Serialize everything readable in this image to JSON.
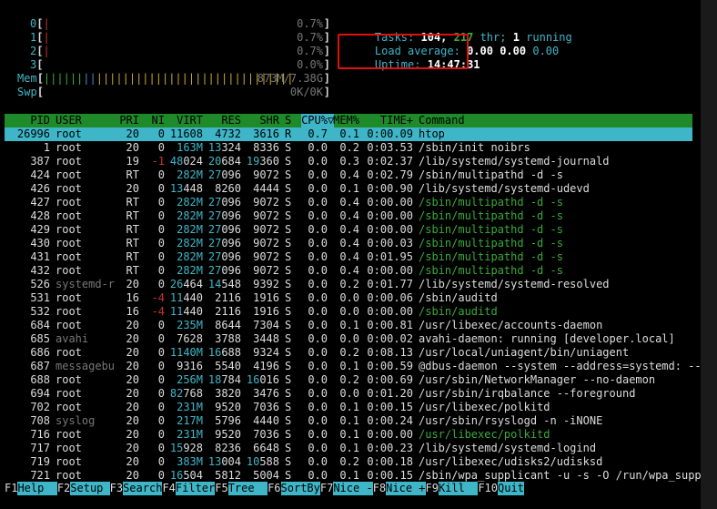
{
  "meters": {
    "cpus": [
      {
        "label": "0",
        "value": "0.7%"
      },
      {
        "label": "1",
        "value": "0.7%"
      },
      {
        "label": "2",
        "value": "0.7%"
      },
      {
        "label": "3",
        "value": "0.0%"
      }
    ],
    "mem": {
      "label": "Mem",
      "bars": "||||||||||||||||||||||||||||||||||||||||",
      "value": "873M/7.38G",
      "fraction": 0.12
    },
    "swp": {
      "label": "Swp",
      "value": "0K/0K"
    }
  },
  "summary": {
    "tasks_label": "Tasks:",
    "tasks": "104,",
    "threads": "217",
    "thr_label": "thr;",
    "running": "1",
    "running_label": "running",
    "load_label": "Load average:",
    "load1": "0.00",
    "load5": "0.00",
    "load15": "0.00",
    "uptime_label": "Uptime:",
    "uptime": "14:47:31"
  },
  "columns": {
    "pid": "PID",
    "user": "USER",
    "pri": "PRI",
    "ni": "NI",
    "virt": "VIRT",
    "res": "RES",
    "shr": "SHR",
    "s": "S",
    "cpu": "CPU%",
    "sort_indicator": "▽",
    "mem": "MEM%",
    "time": "TIME+",
    "command": "Command"
  },
  "processes": [
    {
      "pid": "26996",
      "user": "root",
      "pri": "20",
      "ni": "0",
      "virt": "11608",
      "res": "4732",
      "shr": "3616",
      "s": "R",
      "cpu": "0.7",
      "mem": "0.1",
      "time": "0:00.09",
      "command": "htop",
      "selected": true
    },
    {
      "pid": "1",
      "user": "root",
      "pri": "20",
      "ni": "0",
      "virt": "163M",
      "res": "13324",
      "shr": "8336",
      "s": "S",
      "cpu": "0.0",
      "mem": "0.2",
      "time": "0:03.53",
      "command": "/sbin/init noibrs"
    },
    {
      "pid": "387",
      "user": "root",
      "pri": "19",
      "ni": "-1",
      "virt": "48024",
      "res": "20684",
      "shr": "19360",
      "s": "S",
      "cpu": "0.0",
      "mem": "0.3",
      "time": "0:02.37",
      "command": "/lib/systemd/systemd-journald"
    },
    {
      "pid": "424",
      "user": "root",
      "pri": "RT",
      "ni": "0",
      "virt": "282M",
      "res": "27096",
      "shr": "9072",
      "s": "S",
      "cpu": "0.0",
      "mem": "0.4",
      "time": "0:02.79",
      "command": "/sbin/multipathd -d -s"
    },
    {
      "pid": "426",
      "user": "root",
      "pri": "20",
      "ni": "0",
      "virt": "13448",
      "res": "8260",
      "shr": "4444",
      "s": "S",
      "cpu": "0.0",
      "mem": "0.1",
      "time": "0:00.90",
      "command": "/lib/systemd/systemd-udevd"
    },
    {
      "pid": "427",
      "user": "root",
      "pri": "RT",
      "ni": "0",
      "virt": "282M",
      "res": "27096",
      "shr": "9072",
      "s": "S",
      "cpu": "0.0",
      "mem": "0.4",
      "time": "0:00.00",
      "command": "/sbin/multipathd -d -s",
      "thread": true
    },
    {
      "pid": "428",
      "user": "root",
      "pri": "RT",
      "ni": "0",
      "virt": "282M",
      "res": "27096",
      "shr": "9072",
      "s": "S",
      "cpu": "0.0",
      "mem": "0.4",
      "time": "0:00.00",
      "command": "/sbin/multipathd -d -s",
      "thread": true
    },
    {
      "pid": "429",
      "user": "root",
      "pri": "RT",
      "ni": "0",
      "virt": "282M",
      "res": "27096",
      "shr": "9072",
      "s": "S",
      "cpu": "0.0",
      "mem": "0.4",
      "time": "0:00.00",
      "command": "/sbin/multipathd -d -s",
      "thread": true
    },
    {
      "pid": "430",
      "user": "root",
      "pri": "RT",
      "ni": "0",
      "virt": "282M",
      "res": "27096",
      "shr": "9072",
      "s": "S",
      "cpu": "0.0",
      "mem": "0.4",
      "time": "0:00.03",
      "command": "/sbin/multipathd -d -s",
      "thread": true
    },
    {
      "pid": "431",
      "user": "root",
      "pri": "RT",
      "ni": "0",
      "virt": "282M",
      "res": "27096",
      "shr": "9072",
      "s": "S",
      "cpu": "0.0",
      "mem": "0.4",
      "time": "0:01.95",
      "command": "/sbin/multipathd -d -s",
      "thread": true
    },
    {
      "pid": "432",
      "user": "root",
      "pri": "RT",
      "ni": "0",
      "virt": "282M",
      "res": "27096",
      "shr": "9072",
      "s": "S",
      "cpu": "0.0",
      "mem": "0.4",
      "time": "0:00.00",
      "command": "/sbin/multipathd -d -s",
      "thread": true
    },
    {
      "pid": "526",
      "user": "systemd-r",
      "pri": "20",
      "ni": "0",
      "virt": "26464",
      "res": "14548",
      "shr": "9392",
      "s": "S",
      "cpu": "0.0",
      "mem": "0.2",
      "time": "0:01.77",
      "command": "/lib/systemd/systemd-resolved",
      "grey_user": true
    },
    {
      "pid": "531",
      "user": "root",
      "pri": "16",
      "ni": "-4",
      "virt": "11440",
      "res": "2116",
      "shr": "1916",
      "s": "S",
      "cpu": "0.0",
      "mem": "0.0",
      "time": "0:00.06",
      "command": "/sbin/auditd"
    },
    {
      "pid": "532",
      "user": "root",
      "pri": "16",
      "ni": "-4",
      "virt": "11440",
      "res": "2116",
      "shr": "1916",
      "s": "S",
      "cpu": "0.0",
      "mem": "0.0",
      "time": "0:00.00",
      "command": "/sbin/auditd",
      "thread": true
    },
    {
      "pid": "684",
      "user": "root",
      "pri": "20",
      "ni": "0",
      "virt": "235M",
      "res": "8644",
      "shr": "7304",
      "s": "S",
      "cpu": "0.0",
      "mem": "0.1",
      "time": "0:00.81",
      "command": "/usr/libexec/accounts-daemon"
    },
    {
      "pid": "685",
      "user": "avahi",
      "pri": "20",
      "ni": "0",
      "virt": "7628",
      "res": "3788",
      "shr": "3448",
      "s": "S",
      "cpu": "0.0",
      "mem": "0.0",
      "time": "0:00.02",
      "command": "avahi-daemon: running [developer.local]",
      "grey_user": true
    },
    {
      "pid": "686",
      "user": "root",
      "pri": "20",
      "ni": "0",
      "virt": "1140M",
      "res": "16688",
      "shr": "9324",
      "s": "S",
      "cpu": "0.0",
      "mem": "0.2",
      "time": "0:08.13",
      "command": "/usr/local/uniagent/bin/uniagent"
    },
    {
      "pid": "687",
      "user": "messagebu",
      "pri": "20",
      "ni": "0",
      "virt": "9316",
      "res": "5540",
      "shr": "4196",
      "s": "S",
      "cpu": "0.0",
      "mem": "0.1",
      "time": "0:00.59",
      "command": "@dbus-daemon --system --address=systemd: --",
      "grey_user": true
    },
    {
      "pid": "688",
      "user": "root",
      "pri": "20",
      "ni": "0",
      "virt": "256M",
      "res": "18784",
      "shr": "16016",
      "s": "S",
      "cpu": "0.0",
      "mem": "0.2",
      "time": "0:00.69",
      "command": "/usr/sbin/NetworkManager --no-daemon"
    },
    {
      "pid": "694",
      "user": "root",
      "pri": "20",
      "ni": "0",
      "virt": "82768",
      "res": "3820",
      "shr": "3476",
      "s": "S",
      "cpu": "0.0",
      "mem": "0.0",
      "time": "0:01.20",
      "command": "/usr/sbin/irqbalance --foreground"
    },
    {
      "pid": "702",
      "user": "root",
      "pri": "20",
      "ni": "0",
      "virt": "231M",
      "res": "9520",
      "shr": "7036",
      "s": "S",
      "cpu": "0.0",
      "mem": "0.1",
      "time": "0:00.15",
      "command": "/usr/libexec/polkitd"
    },
    {
      "pid": "708",
      "user": "syslog",
      "pri": "20",
      "ni": "0",
      "virt": "217M",
      "res": "5796",
      "shr": "4440",
      "s": "S",
      "cpu": "0.0",
      "mem": "0.1",
      "time": "0:00.24",
      "command": "/usr/sbin/rsyslogd -n -iNONE",
      "grey_user": true
    },
    {
      "pid": "716",
      "user": "root",
      "pri": "20",
      "ni": "0",
      "virt": "231M",
      "res": "9520",
      "shr": "7036",
      "s": "S",
      "cpu": "0.0",
      "mem": "0.1",
      "time": "0:00.00",
      "command": "/usr/libexec/polkitd",
      "thread": true
    },
    {
      "pid": "717",
      "user": "root",
      "pri": "20",
      "ni": "0",
      "virt": "15928",
      "res": "8236",
      "shr": "6648",
      "s": "S",
      "cpu": "0.0",
      "mem": "0.1",
      "time": "0:00.23",
      "command": "/lib/systemd/systemd-logind"
    },
    {
      "pid": "719",
      "user": "root",
      "pri": "20",
      "ni": "0",
      "virt": "383M",
      "res": "13004",
      "shr": "10588",
      "s": "S",
      "cpu": "0.0",
      "mem": "0.2",
      "time": "0:00.18",
      "command": "/usr/libexec/udisks2/udisksd"
    },
    {
      "pid": "721",
      "user": "root",
      "pri": "20",
      "ni": "0",
      "virt": "16504",
      "res": "5812",
      "shr": "5004",
      "s": "S",
      "cpu": "0.0",
      "mem": "0.1",
      "time": "0:00.15",
      "command": "/sbin/wpa_supplicant -u -s -O /run/wpa_supp"
    }
  ],
  "footer": [
    {
      "key": "F1",
      "name": "Help  "
    },
    {
      "key": "F2",
      "name": "Setup "
    },
    {
      "key": "F3",
      "name": "Search"
    },
    {
      "key": "F4",
      "name": "Filter"
    },
    {
      "key": "F5",
      "name": "Tree  "
    },
    {
      "key": "F6",
      "name": "SortBy"
    },
    {
      "key": "F7",
      "name": "Nice -"
    },
    {
      "key": "F8",
      "name": "Nice +"
    },
    {
      "key": "F9",
      "name": "Kill  "
    },
    {
      "key": "F10",
      "name": "Quit"
    }
  ],
  "colors": {
    "accent_cyan": "#3fb6c8",
    "header_green": "#1f8a2a",
    "highlight_red": "#e01010"
  }
}
